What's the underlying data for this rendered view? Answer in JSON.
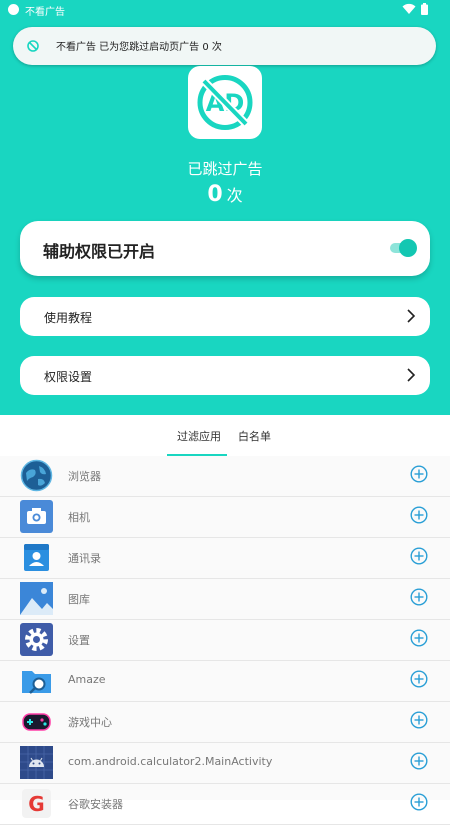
{
  "status_bar": {
    "app_title": "不看广告"
  },
  "toast": {
    "text": "不看广告 已为您跳过启动页广告 0 次"
  },
  "logo": {
    "text": "AD"
  },
  "stats": {
    "label": "已跳过广告",
    "count": "0",
    "unit": "次"
  },
  "accessibility_card": {
    "label": "辅助权限已开启",
    "enabled": true
  },
  "menu": {
    "tutorial": "使用教程",
    "permissions": "权限设置"
  },
  "tabs": {
    "filter_apps": "过滤应用",
    "whitelist": "白名单"
  },
  "apps": [
    {
      "name": "浏览器",
      "icon": "globe-icon"
    },
    {
      "name": "相机",
      "icon": "camera-icon"
    },
    {
      "name": "通讯录",
      "icon": "contacts-icon"
    },
    {
      "name": "图库",
      "icon": "gallery-icon"
    },
    {
      "name": "设置",
      "icon": "gear-icon"
    },
    {
      "name": "Amaze",
      "icon": "folder-search-icon"
    },
    {
      "name": "游戏中心",
      "icon": "gamepad-icon"
    },
    {
      "name": "com.android.calculator2.MainActivity",
      "icon": "android-icon"
    },
    {
      "name": "谷歌安装器",
      "icon": "google-installer-icon"
    }
  ],
  "colors": {
    "accent": "#19d6c1",
    "add_icon": "#2a9fd6"
  }
}
